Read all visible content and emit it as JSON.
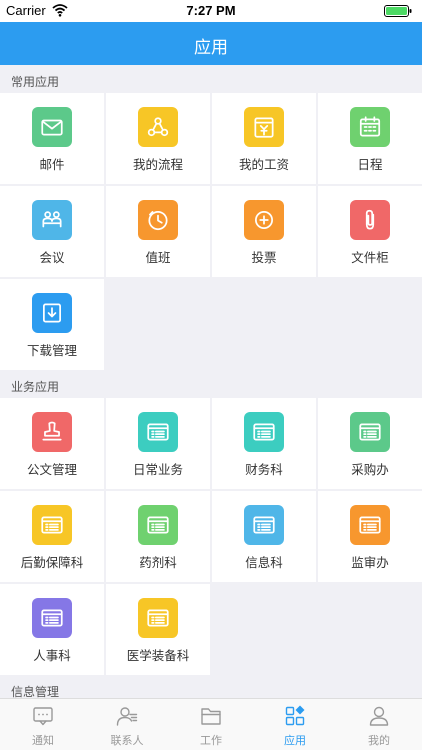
{
  "status_bar": {
    "carrier": "Carrier",
    "time": "7:27 PM"
  },
  "nav": {
    "title": "应用"
  },
  "sections": [
    {
      "title": "常用应用",
      "items": [
        {
          "label": "邮件",
          "icon": "mail-icon",
          "color": "#5cc98a"
        },
        {
          "label": "我的流程",
          "icon": "workflow-icon",
          "color": "#f7c626"
        },
        {
          "label": "我的工资",
          "icon": "salary-icon",
          "color": "#f7c626"
        },
        {
          "label": "日程",
          "icon": "calendar-icon",
          "color": "#6fd16f"
        },
        {
          "label": "会议",
          "icon": "meeting-icon",
          "color": "#4fb6e8"
        },
        {
          "label": "值班",
          "icon": "duty-icon",
          "color": "#f7972e"
        },
        {
          "label": "投票",
          "icon": "vote-icon",
          "color": "#f7972e"
        },
        {
          "label": "文件柜",
          "icon": "paperclip-icon",
          "color": "#f06868"
        },
        {
          "label": "下载管理",
          "icon": "download-icon",
          "color": "#2c9cf0"
        }
      ]
    },
    {
      "title": "业务应用",
      "items": [
        {
          "label": "公文管理",
          "icon": "stamp-icon",
          "color": "#f06868"
        },
        {
          "label": "日常业务",
          "icon": "list-card-icon",
          "color": "#3ccdc0"
        },
        {
          "label": "财务科",
          "icon": "list-card-icon",
          "color": "#3ccdc0"
        },
        {
          "label": "采购办",
          "icon": "list-card-icon",
          "color": "#5cc98a"
        },
        {
          "label": "后勤保障科",
          "icon": "list-card-icon",
          "color": "#f7c626"
        },
        {
          "label": "药剂科",
          "icon": "list-card-icon",
          "color": "#6fd16f"
        },
        {
          "label": "信息科",
          "icon": "list-card-icon",
          "color": "#4fb6e8"
        },
        {
          "label": "监审办",
          "icon": "list-card-icon",
          "color": "#f7972e"
        },
        {
          "label": "人事科",
          "icon": "list-card-icon",
          "color": "#8577e6"
        },
        {
          "label": "医学装备科",
          "icon": "list-card-icon",
          "color": "#f7c626"
        }
      ]
    },
    {
      "title": "信息管理",
      "items": []
    }
  ],
  "tabs": [
    {
      "label": "通知",
      "icon": "message-icon",
      "active": false
    },
    {
      "label": "联系人",
      "icon": "contacts-icon",
      "active": false
    },
    {
      "label": "工作",
      "icon": "folder-icon",
      "active": false
    },
    {
      "label": "应用",
      "icon": "apps-icon",
      "active": true
    },
    {
      "label": "我的",
      "icon": "profile-icon",
      "active": false
    }
  ],
  "colors": {
    "accent": "#2c9cf0",
    "inactive": "#999999",
    "background": "#f0f0f5"
  }
}
